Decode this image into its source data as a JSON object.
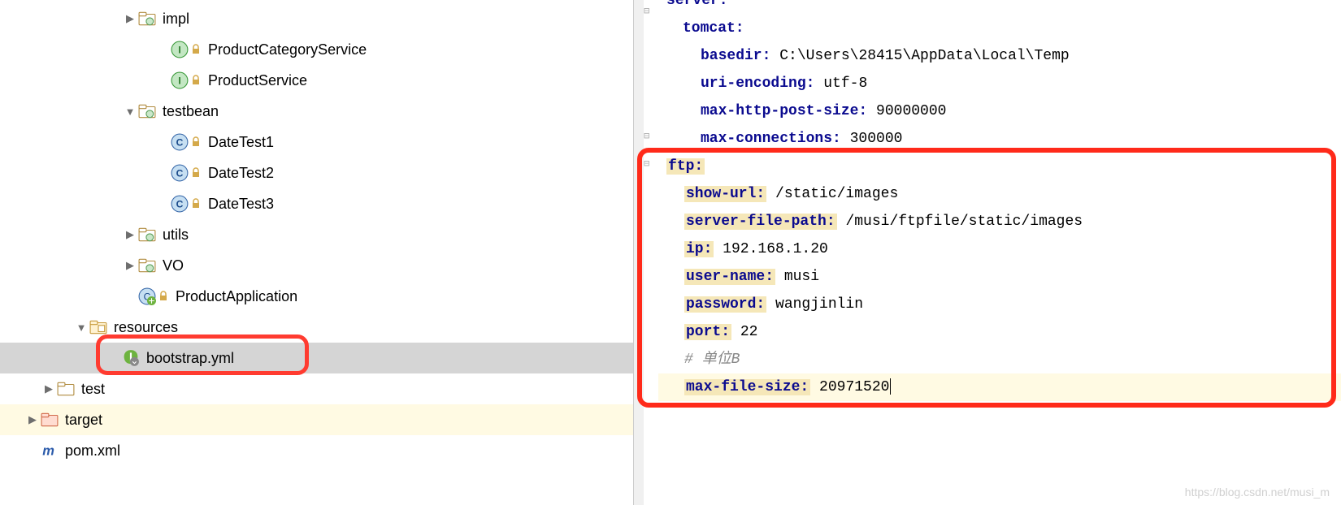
{
  "tree": {
    "impl": "impl",
    "productCategoryService": "ProductCategoryService",
    "productService": "ProductService",
    "testbean": "testbean",
    "dateTest1": "DateTest1",
    "dateTest2": "DateTest2",
    "dateTest3": "DateTest3",
    "utils": "utils",
    "vo": "VO",
    "productApplication": "ProductApplication",
    "resources": "resources",
    "bootstrap": "bootstrap.yml",
    "test": "test",
    "target": "target",
    "pom": "pom.xml"
  },
  "code": {
    "server": "server:",
    "tomcat": "tomcat:",
    "basedir_k": "basedir:",
    "basedir_v": " C:\\Users\\28415\\AppData\\Local\\Temp",
    "uriEncoding_k": "uri-encoding:",
    "uriEncoding_v": " utf-8",
    "maxHttp_k": "max-http-post-size:",
    "maxHttp_v": " 90000000",
    "maxConn_k": "max-connections:",
    "maxConn_v": " 300000",
    "ftp": "ftp:",
    "showUrl_k": "show-url:",
    "showUrl_v": " /static/images",
    "serverFilePath_k": "server-file-path:",
    "serverFilePath_v": " /musi/ftpfile/static/images",
    "ip_k": "ip:",
    "ip_v": " 192.168.1.20",
    "userName_k": "user-name:",
    "userName_v": " musi",
    "password_k": "password:",
    "password_v": " wangjinlin",
    "port_k": "port:",
    "port_v": " 22",
    "comment": "# 单位B",
    "maxFileSize_k": "max-file-size:",
    "maxFileSize_v": " 20971520"
  },
  "watermark": "https://blog.csdn.net/musi_m"
}
